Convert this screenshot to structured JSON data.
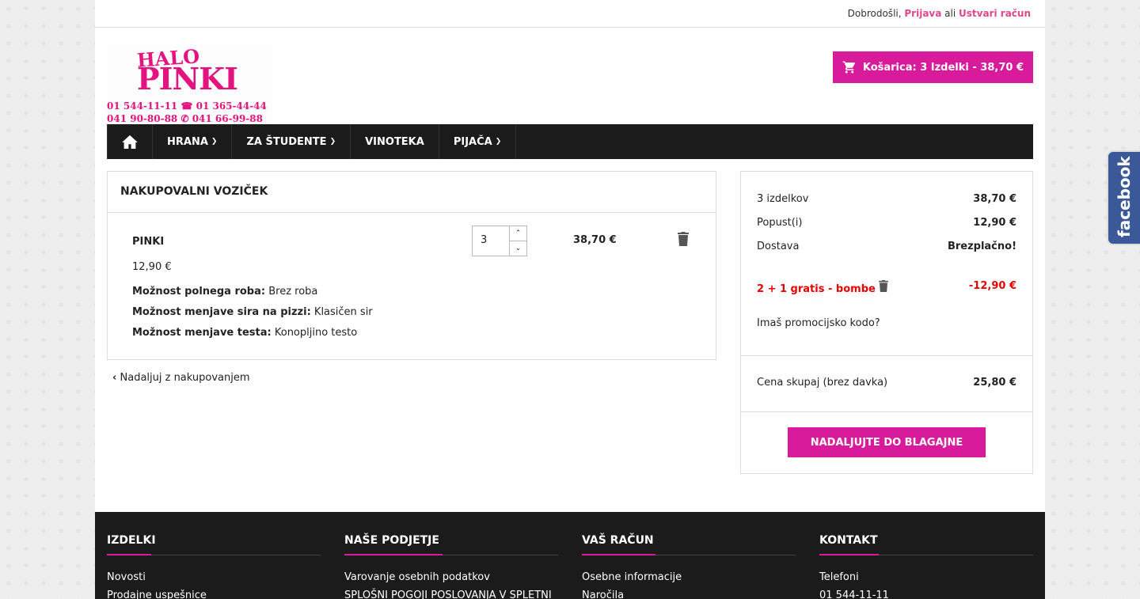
{
  "topbar": {
    "welcome": "Dobrodošli,",
    "login": "Prijava",
    "or": "ali",
    "register": "Ustvari račun"
  },
  "logo": {
    "line1": "HALO",
    "line2": "PINKI",
    "phones1": "01 544-11-11 ☎ 01 365-44-44",
    "phones2": "041 90-80-88 ✆ 041 66-99-88"
  },
  "cart_button": "Košarica: 3 Izdelki - 38,70 €",
  "nav": [
    {
      "label": "HRANA",
      "dropdown": true
    },
    {
      "label": "ZA ŠTUDENTE",
      "dropdown": true
    },
    {
      "label": "VINOTEKA",
      "dropdown": false
    },
    {
      "label": "PIJAČA",
      "dropdown": true
    }
  ],
  "cart": {
    "title": "NAKUPOVALNI VOZIČEK",
    "product": {
      "name": "PINKI",
      "price": "12,90 €",
      "quantity": "3",
      "total": "38,70 €",
      "attributes": [
        {
          "label": "Možnost polnega roba:",
          "value": "Brez roba"
        },
        {
          "label": "Možnost menjave sira na pizzi:",
          "value": "Klasičen sir"
        },
        {
          "label": "Možnost menjave testa:",
          "value": "Konopljino testo"
        }
      ]
    },
    "continue": "Nadaljuj z nakupovanjem"
  },
  "summary": {
    "items_label": "3 izdelkov",
    "items_value": "38,70 €",
    "discount_label": "Popust(i)",
    "discount_value": "12,90 €",
    "shipping_label": "Dostava",
    "shipping_value": "Brezplačno!",
    "promo_name": "2 + 1 gratis - bombe",
    "promo_value": "-12,90 €",
    "promo_question": "Imaš promocijsko kodo?",
    "total_label": "Cena skupaj (brez davka)",
    "total_value": "25,80 €",
    "checkout": "NADALJUJTE DO BLAGAJNE"
  },
  "footer": [
    {
      "title": "IZDELKI",
      "links": [
        "Novosti",
        "Prodajne uspešnice"
      ]
    },
    {
      "title": "NAŠE PODJETJE",
      "links": [
        "Varovanje osebnih podatkov",
        "SPLOŠNI POGOJI POSLOVANJA V SPLETNI"
      ]
    },
    {
      "title": "VAŠ RAČUN",
      "links": [
        "Osebne informacije",
        "Naročila"
      ]
    },
    {
      "title": "KONTAKT",
      "links": [
        "Telefoni",
        "01 544-11-11"
      ]
    }
  ],
  "facebook": "facebook",
  "colors": {
    "accent": "#d81b9a",
    "promo": "#e60000",
    "dark": "#1b1b1b"
  }
}
